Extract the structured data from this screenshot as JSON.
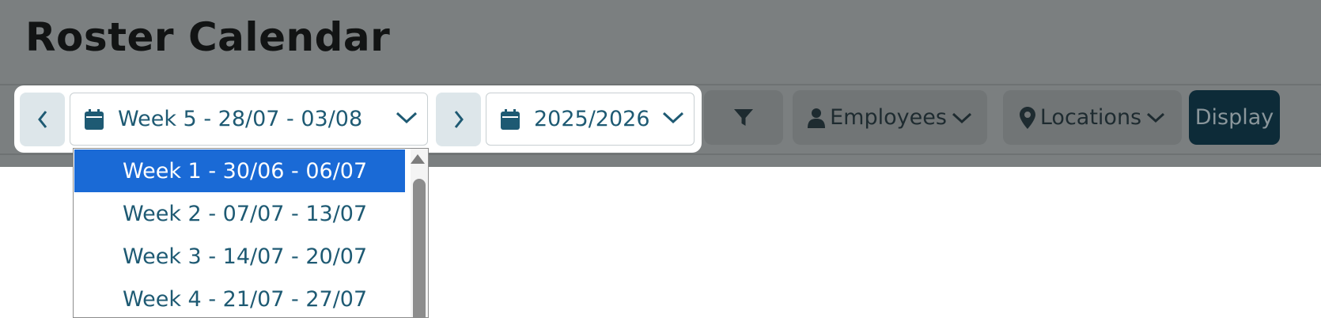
{
  "page": {
    "title": "Roster Calendar"
  },
  "toolbar": {
    "prev_icon": "chevron-left-icon",
    "next_icon": "chevron-right-icon",
    "week_select": {
      "value": "Week 5 - 28/07 - 03/08"
    },
    "year_select": {
      "value": "2025/2026"
    },
    "filter_icon": "filter-icon",
    "employees_label": "Employees",
    "locations_label": "Locations",
    "display_label": "Display"
  },
  "week_dropdown": {
    "options": [
      "Week 1 - 30/06 - 06/07",
      "Week 2 - 07/07 - 13/07",
      "Week 3 - 14/07 - 20/07",
      "Week 4 - 21/07 - 27/07"
    ],
    "highlighted_index": 0
  },
  "colors": {
    "overlay": "#7b7f80",
    "accent": "#1e5a73",
    "selected_option": "#1a6ad6",
    "display_button": "#0d2b38"
  }
}
